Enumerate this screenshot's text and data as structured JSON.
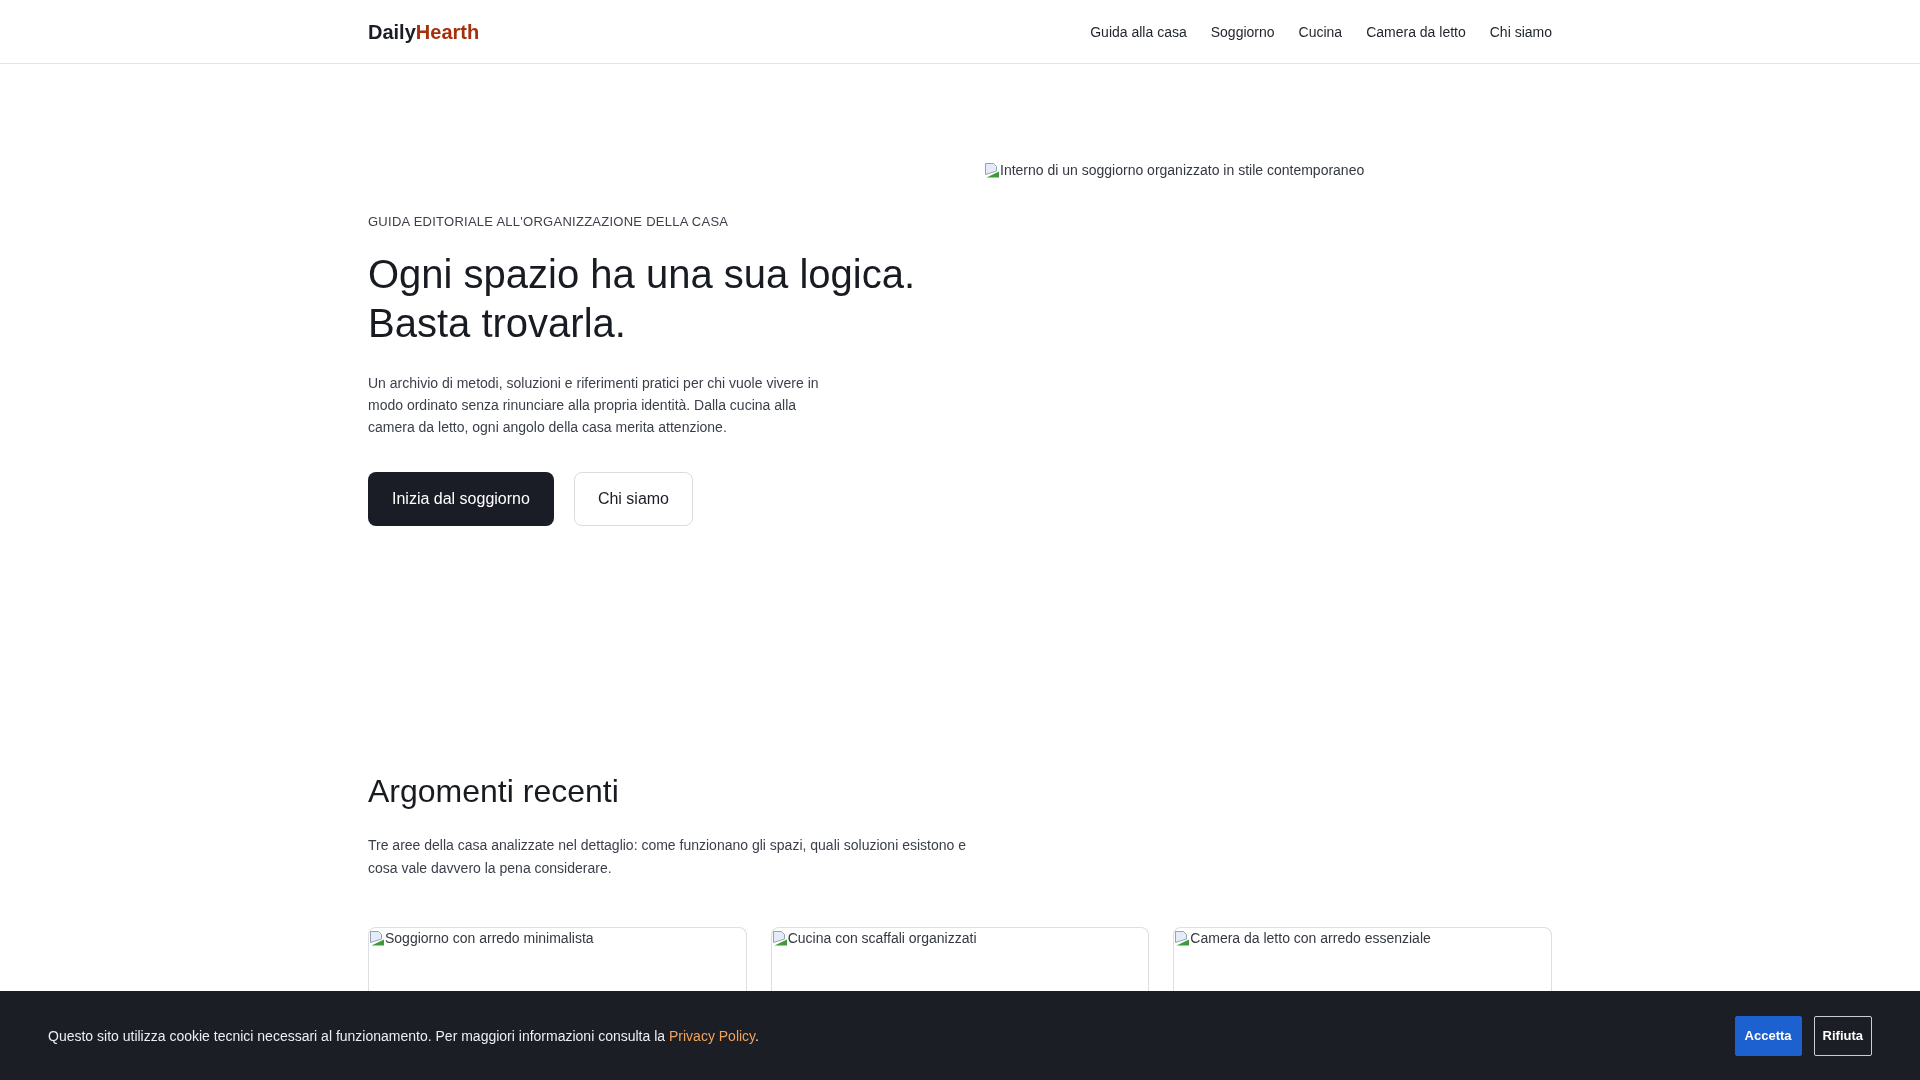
{
  "header": {
    "logo": {
      "first": "Daily",
      "second": "Hearth"
    },
    "nav": [
      "Guida alla casa",
      "Soggiorno",
      "Cucina",
      "Camera da letto",
      "Chi siamo"
    ]
  },
  "hero": {
    "kicker": "GUIDA EDITORIALE ALL'ORGANIZZAZIONE DELLA CASA",
    "title_lines": [
      "Ogni spazio ha una sua logica.",
      "Basta trovarla."
    ],
    "text": "Un archivio di metodi, soluzioni e riferimenti pratici per chi vuole vivere in modo ordinato senza rinunciare alla propria identità. Dalla cucina alla camera da letto, ogni angolo della casa merita attenzione.",
    "buttons": [
      {
        "label": "Inizia dal soggiorno",
        "kind": "primary"
      },
      {
        "label": "Chi siamo",
        "kind": "outline"
      }
    ],
    "image_alt": "Interno di un soggiorno organizzato in stile contemporaneo"
  },
  "recent": {
    "title": "Argomenti recenti",
    "text": "Tre aree della casa analizzate nel dettaglio: come funzionano gli spazi, quali soluzioni esistono e cosa vale davvero la pena considerare.",
    "cards": [
      {
        "image_alt": "Soggiorno con arredo minimalista"
      },
      {
        "image_alt": "Cucina con scaffali organizzati"
      },
      {
        "image_alt": "Camera da letto con arredo essenziale"
      }
    ]
  },
  "cookie_banner": {
    "text": "Questo sito utilizza cookie tecnici necessari al funzionamento. Per maggiori informazioni consulta la",
    "link": "Privacy Policy",
    "text_after": ".",
    "buttons": [
      {
        "label": "Accetta",
        "kind": "accept"
      },
      {
        "label": "Rifiuta",
        "kind": "reject"
      }
    ]
  }
}
